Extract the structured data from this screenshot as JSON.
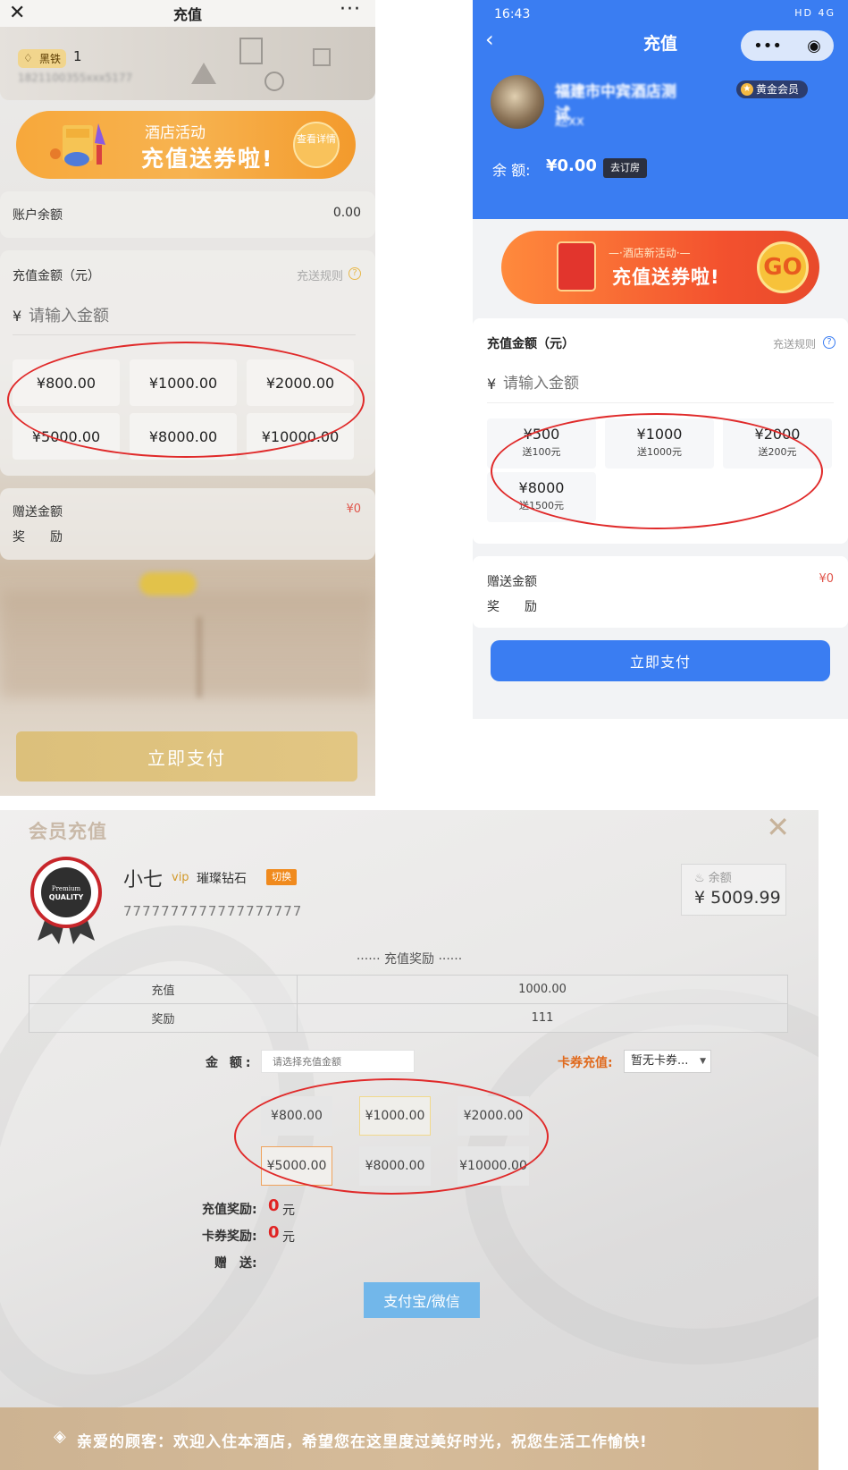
{
  "panel1": {
    "nav": {
      "title": "充值",
      "close_icon": "close-icon",
      "more_icon": "more-icon"
    },
    "member": {
      "level": "黑铁",
      "level_num": "1",
      "phone_masked": "1821100355xxx5177"
    },
    "banner": {
      "line1": "酒店活动",
      "line2": "充值送券啦!",
      "detail": "查看详情"
    },
    "balance": {
      "label": "账户余额",
      "value": "0.00"
    },
    "recharge": {
      "label": "充值金额（元）",
      "rules": "充送规则",
      "currency": "¥",
      "placeholder": "请输入金额",
      "options": [
        "¥800.00",
        "¥1000.00",
        "¥2000.00",
        "¥5000.00",
        "¥8000.00",
        "¥10000.00"
      ]
    },
    "gift": {
      "label": "赠送金额",
      "value": "¥0",
      "reward_label": "奖　　励"
    },
    "pay_button": "立即支付"
  },
  "panel2": {
    "status": {
      "time": "16:43",
      "right": "HD 4G"
    },
    "nav": {
      "title": "充值",
      "back_icon": "back-icon"
    },
    "user": {
      "name_blurred": "福建市中宾酒店测试",
      "sub_blurred": "赵xx",
      "vip": "黄金会员"
    },
    "balance": {
      "label": "余  额:",
      "value": "¥0.00",
      "action": "去订房"
    },
    "banner": {
      "line1": "—·酒店新活动·—",
      "line2": "充值送券啦!",
      "go": "GO"
    },
    "recharge": {
      "label": "充值金额（元）",
      "rules": "充送规则",
      "currency": "¥",
      "placeholder": "请输入金额",
      "options": [
        {
          "amount": "¥500",
          "gift": "送100元"
        },
        {
          "amount": "¥1000",
          "gift": "送1000元"
        },
        {
          "amount": "¥2000",
          "gift": "送200元"
        },
        {
          "amount": "¥8000",
          "gift": "送1500元"
        }
      ]
    },
    "gift": {
      "label": "赠送金额",
      "value": "¥0",
      "reward_label": "奖　　励"
    },
    "pay_button": "立即支付"
  },
  "panel3": {
    "title": "会员充值",
    "user": {
      "name": "小七",
      "vip": "vip",
      "level": "璀璨钻石",
      "switch": "切换",
      "card_no": "7777777777777777777"
    },
    "medal": {
      "line1": "Premium",
      "line2": "QUALITY"
    },
    "balance": {
      "label": "余额",
      "value": "¥ 5009.99"
    },
    "reward_title": "······ 充值奖励 ······",
    "reward_table": [
      {
        "label": "充值",
        "value": "1000.00"
      },
      {
        "label": "奖励",
        "value": "111"
      }
    ],
    "amount": {
      "label": "金  额:",
      "placeholder": "请选择充值金额"
    },
    "coupon": {
      "label": "卡券充值:",
      "selected": "暂无卡券..."
    },
    "options": [
      "¥800.00",
      "¥1000.00",
      "¥2000.00",
      "¥5000.00",
      "¥8000.00",
      "¥10000.00"
    ],
    "rewards": {
      "recharge_label": "充值奖励:",
      "recharge_value": "0",
      "recharge_unit": "元",
      "coupon_label": "卡券奖励:",
      "coupon_value": "0",
      "coupon_unit": "元",
      "gift_label": "赠　送:"
    },
    "pay_button": "支付宝/微信",
    "footer": "亲爱的顾客：欢迎入住本酒店，希望您在这里度过美好时光，祝您生活工作愉快!"
  },
  "colors": {
    "panel1_gold": "#dcc07b",
    "panel2_blue": "#3a7df2",
    "panel3_blue": "#72b7ea",
    "annotation_red": "#e02a2a"
  }
}
